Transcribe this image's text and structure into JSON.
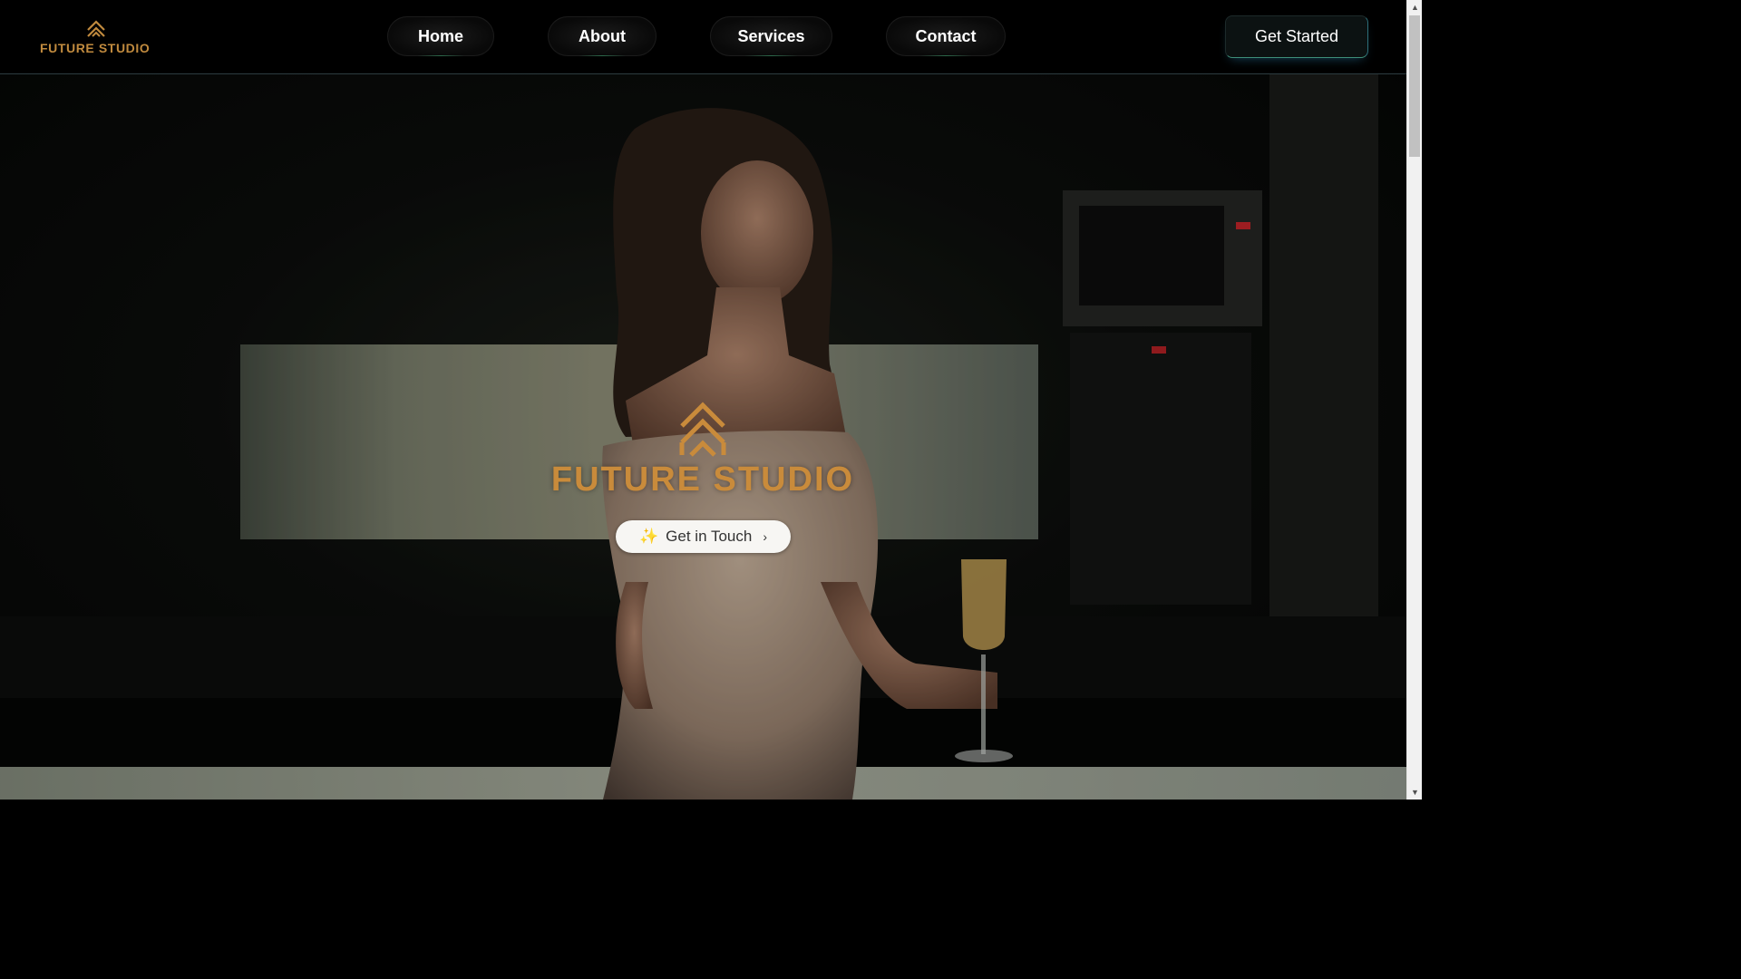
{
  "brand": {
    "name": "FUTURE STUDIO",
    "accent_color": "#c98b3b"
  },
  "nav": {
    "items": [
      {
        "label": "Home"
      },
      {
        "label": "About"
      },
      {
        "label": "Services"
      },
      {
        "label": "Contact"
      }
    ],
    "cta_label": "Get Started"
  },
  "hero": {
    "title": "FUTURE STUDIO",
    "button_icon": "sparkles-icon",
    "button_label": "Get in Touch",
    "button_chevron": "›",
    "background": "video-frame"
  },
  "scrollbar": {
    "up_icon": "▲",
    "down_icon": "▼"
  }
}
